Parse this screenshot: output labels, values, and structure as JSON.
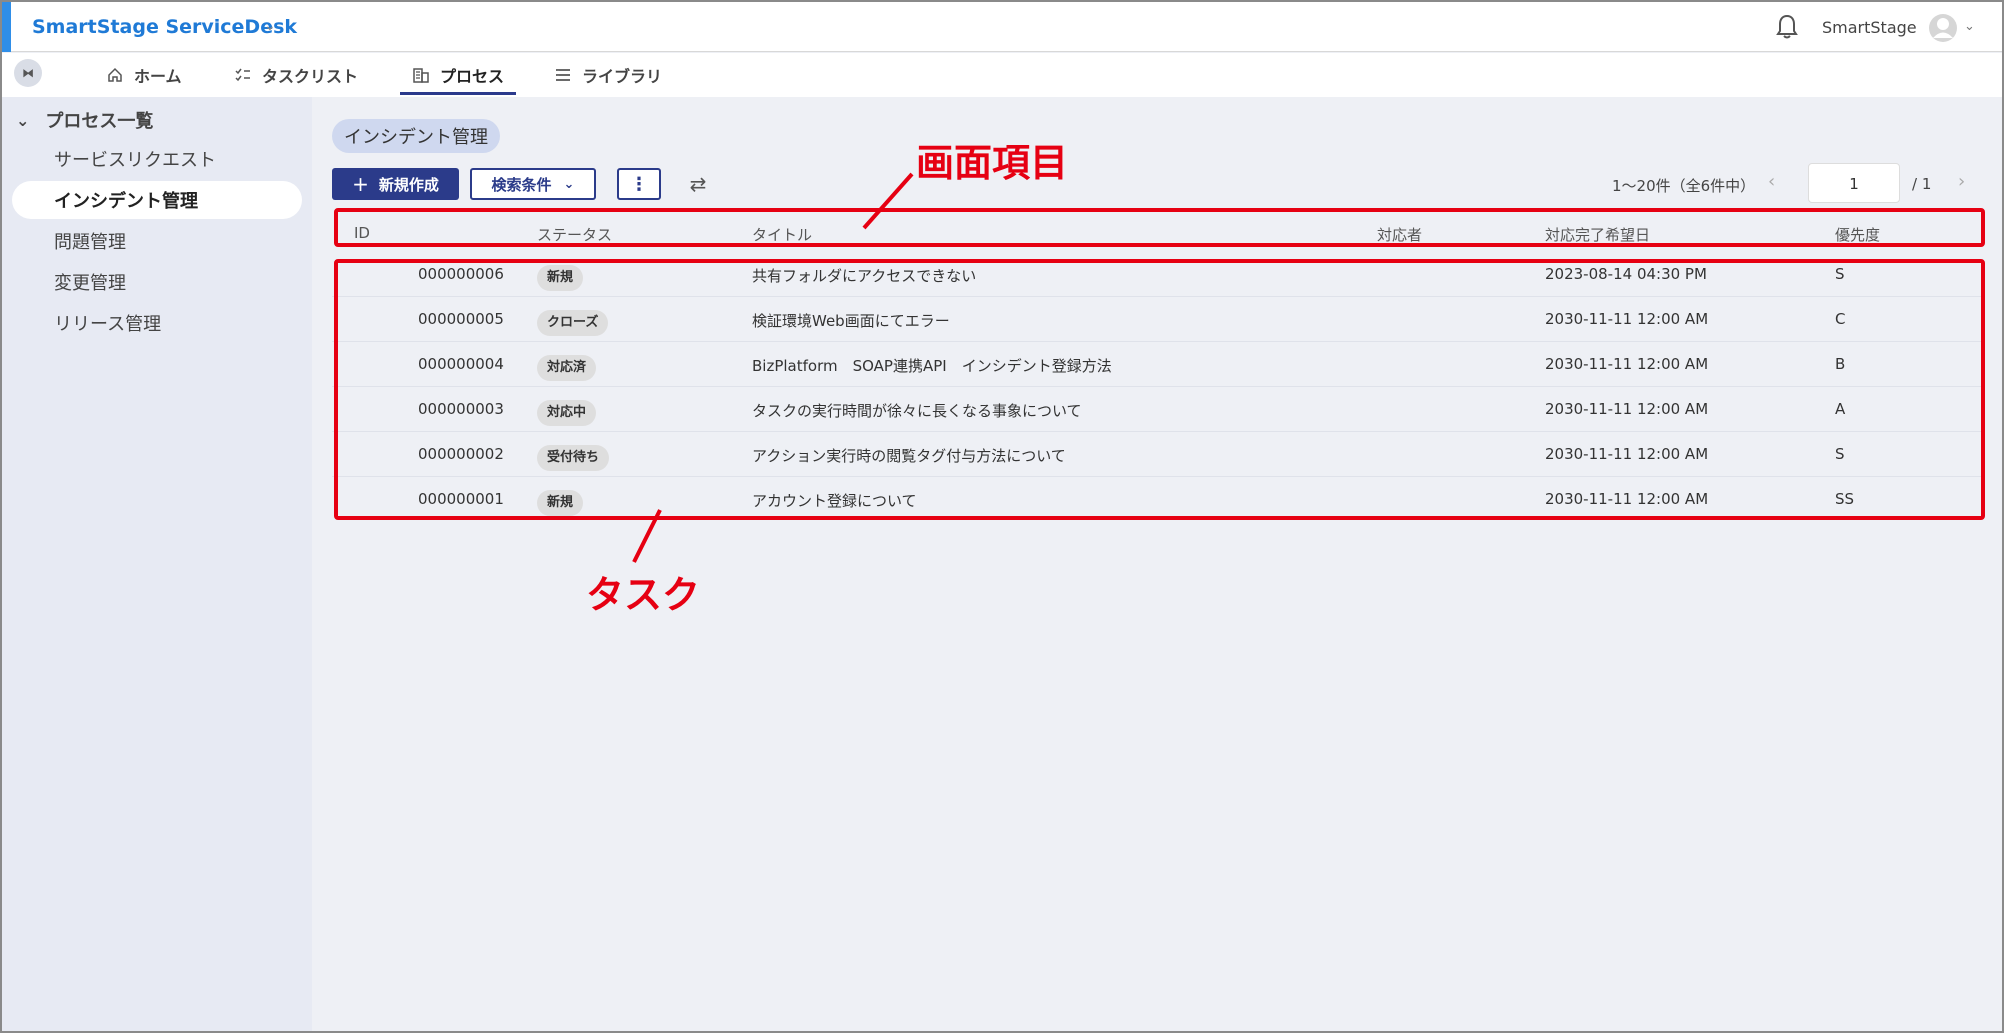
{
  "header": {
    "app_title": "SmartStage ServiceDesk",
    "user_name": "SmartStage"
  },
  "tabs": [
    {
      "label": "ホーム",
      "icon": "home-icon"
    },
    {
      "label": "タスクリスト",
      "icon": "checklist-icon"
    },
    {
      "label": "プロセス",
      "icon": "building-icon",
      "active": true
    },
    {
      "label": "ライブラリ",
      "icon": "list-icon"
    }
  ],
  "sidebar": {
    "heading": "プロセス一覧",
    "items": [
      {
        "label": "サービスリクエスト"
      },
      {
        "label": "インシデント管理",
        "active": true
      },
      {
        "label": "問題管理"
      },
      {
        "label": "変更管理"
      },
      {
        "label": "リリース管理"
      }
    ]
  },
  "main": {
    "chip": "インシデント管理",
    "new_button": "新規作成",
    "search_button": "検索条件",
    "pager": {
      "range_text": "1〜20件（全6件中）",
      "page": "1",
      "total": "/ 1"
    },
    "columns": [
      "ID",
      "ステータス",
      "タイトル",
      "対応者",
      "対応完了希望日",
      "優先度"
    ],
    "rows": [
      {
        "id": "000000006",
        "status": "新規",
        "title": "共有フォルダにアクセスできない",
        "assignee": "",
        "due": "2023-08-14 04:30 PM",
        "priority": "S"
      },
      {
        "id": "000000005",
        "status": "クローズ",
        "title": "検証環境Web画面にてエラー",
        "assignee": "",
        "due": "2030-11-11 12:00 AM",
        "priority": "C"
      },
      {
        "id": "000000004",
        "status": "対応済",
        "title": "BizPlatform　SOAP連携API　インシデント登録方法",
        "assignee": "",
        "due": "2030-11-11 12:00 AM",
        "priority": "B"
      },
      {
        "id": "000000003",
        "status": "対応中",
        "title": "タスクの実行時間が徐々に長くなる事象について",
        "assignee": "",
        "due": "2030-11-11 12:00 AM",
        "priority": "A"
      },
      {
        "id": "000000002",
        "status": "受付待ち",
        "title": "アクション実行時の閲覧タグ付与方法について",
        "assignee": "",
        "due": "2030-11-11 12:00 AM",
        "priority": "S"
      },
      {
        "id": "000000001",
        "status": "新規",
        "title": "アカウント登録について",
        "assignee": "",
        "due": "2030-11-11 12:00 AM",
        "priority": "SS"
      }
    ]
  },
  "annotations": {
    "header_label": "画面項目",
    "rows_label": "タスク",
    "color": "#e60012"
  }
}
